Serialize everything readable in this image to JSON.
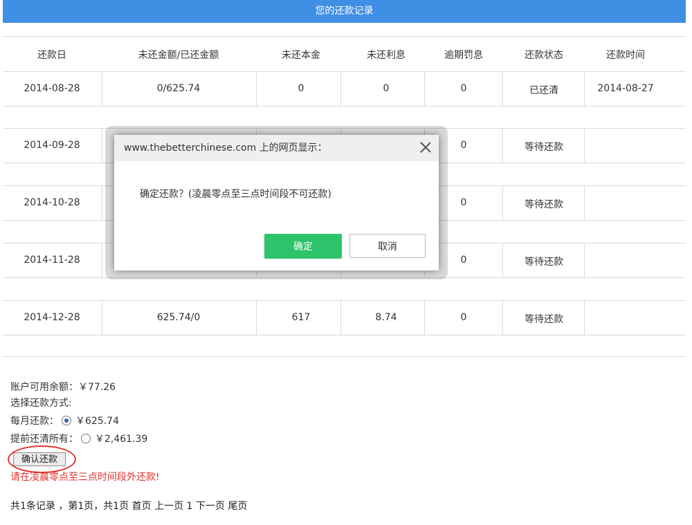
{
  "header": {
    "title": "您的还款记录"
  },
  "table": {
    "columns": [
      "还款日",
      "未还金额/已还金额",
      "未还本金",
      "未还利息",
      "逾期罚息",
      "还款状态",
      "还款时间"
    ],
    "rows": [
      [
        "2014-08-28",
        "0/625.74",
        "0",
        "0",
        "0",
        "已还清",
        "2014-08-27"
      ],
      [
        "2014-09-28",
        "",
        "",
        "",
        "0",
        "等待还款",
        ""
      ],
      [
        "2014-10-28",
        "",
        "",
        "",
        "0",
        "等待还款",
        ""
      ],
      [
        "2014-11-28",
        "",
        "",
        "",
        "0",
        "等待还款",
        ""
      ],
      [
        "2014-12-28",
        "625.74/0",
        "617",
        "8.74",
        "0",
        "等待还款",
        ""
      ]
    ]
  },
  "account": {
    "balance_label": "账户可用余额：",
    "balance_value": "￥77.26",
    "method_label": "选择还款方式:",
    "monthly_label": "每月还款：",
    "monthly_value": "￥625.74",
    "monthly_selected": true,
    "prepay_label": "提前还清所有：",
    "prepay_value": "￥2,461.39",
    "prepay_selected": false
  },
  "confirm_button": "确认还款",
  "warning": "请在凌晨零点至三点时间段外还款!",
  "pager": {
    "summary": "共1条记录 ，第1页，共1页",
    "first": "首页",
    "prev": "上一页",
    "current": "1",
    "next": "下一页",
    "last": "尾页"
  },
  "dialog": {
    "title": "www.thebetterchinese.com 上的网页显示：",
    "message": "确定还款？(凌晨零点至三点时间段不可还款)",
    "ok": "确定",
    "cancel": "取消"
  },
  "colors": {
    "header_bg": "#3f8fe5",
    "ok_button": "#2ec36b",
    "warning": "#e0322c"
  }
}
